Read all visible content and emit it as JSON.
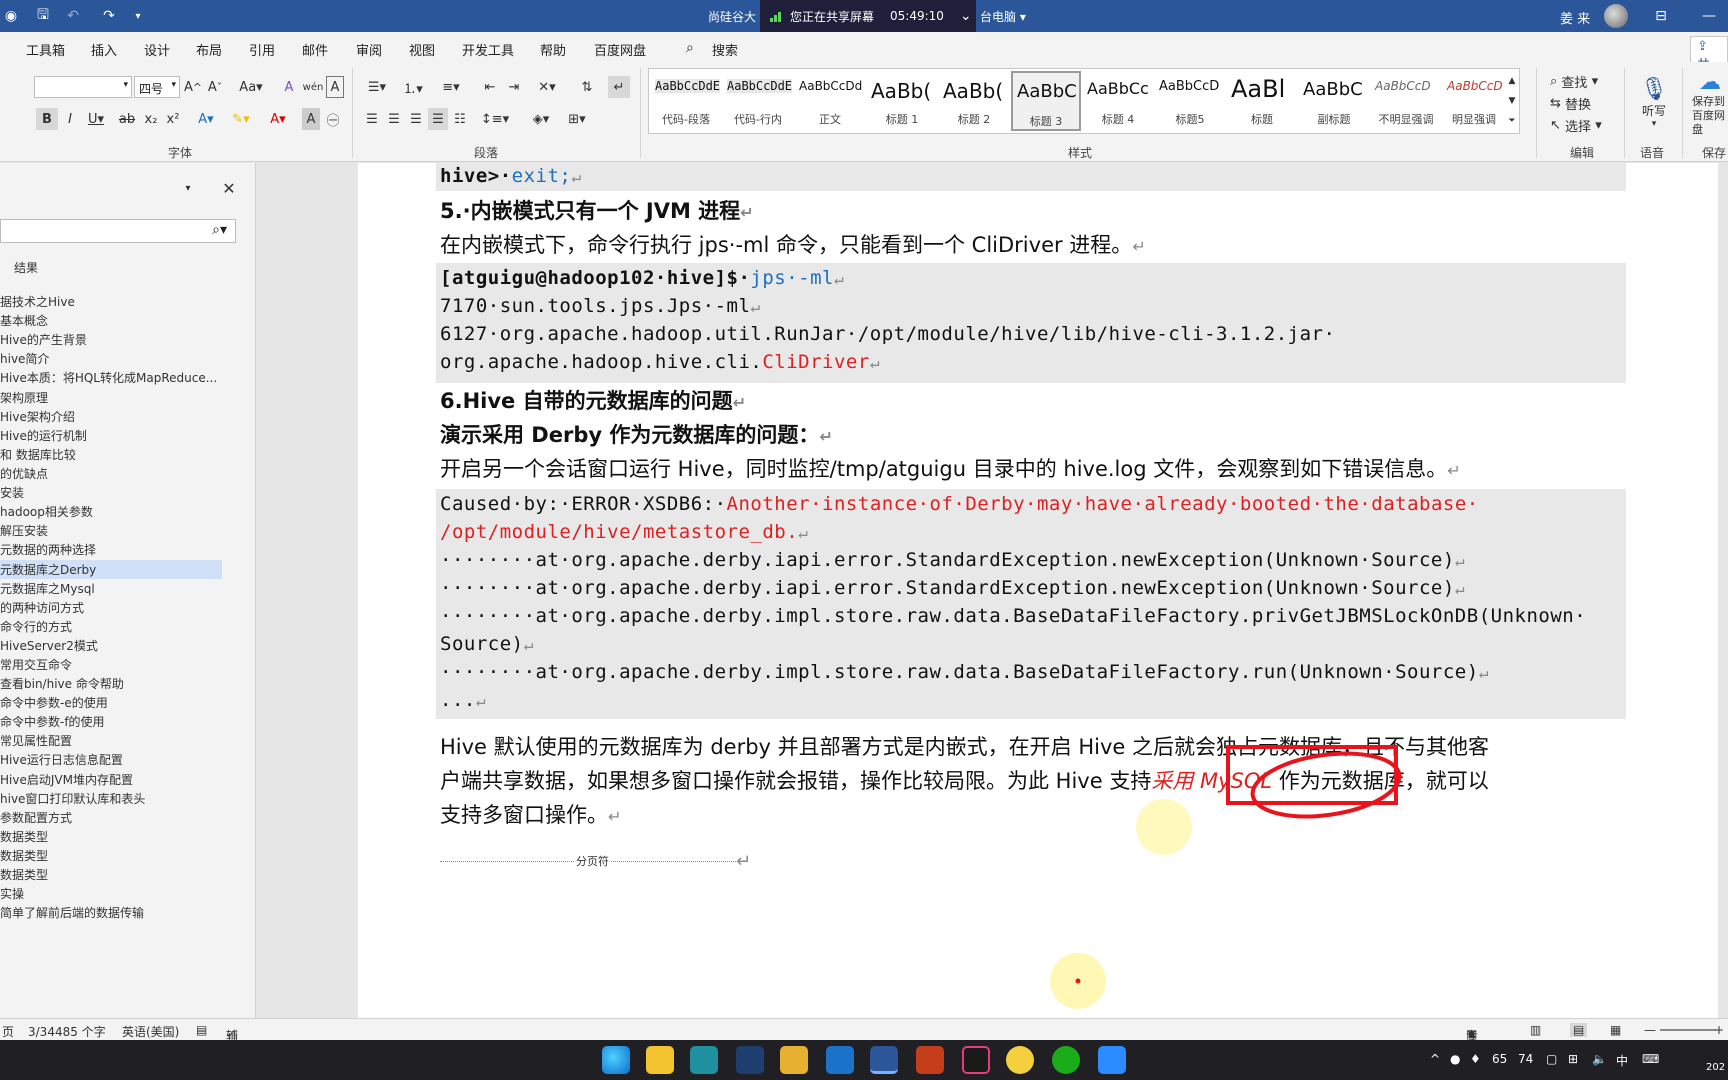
{
  "titlebar": {
    "doc_title_left": "尚硅谷大",
    "share_text": "您正在共享屏幕",
    "share_time": "05:49:10",
    "doc_title_right": "台电脑",
    "user_name": "姜 来"
  },
  "menu": {
    "tabs": [
      "工具箱",
      "插入",
      "设计",
      "布局",
      "引用",
      "邮件",
      "审阅",
      "视图",
      "开发工具",
      "帮助",
      "百度网盘",
      "搜索"
    ],
    "share_label": "共享"
  },
  "ribbon": {
    "font_size": "四号",
    "group_font": "字体",
    "group_paragraph": "段落",
    "group_styles": "样式",
    "group_edit": "编辑",
    "group_voice": "语音",
    "group_save": "保存",
    "find": "查找",
    "replace": "替换",
    "select": "选择",
    "dictate": "听写",
    "save_to_baidu": "保存到百度网盘",
    "styles": [
      {
        "preview": "AaBbCcDdE",
        "name": "代码-段落"
      },
      {
        "preview": "AaBbCcDdE",
        "name": "代码-行内"
      },
      {
        "preview": "AaBbCcDd",
        "name": "正文"
      },
      {
        "preview": "AaBb(",
        "name": "标题 1"
      },
      {
        "preview": "AaBb(",
        "name": "标题 2"
      },
      {
        "preview": "AaBbC",
        "name": "标题 3"
      },
      {
        "preview": "AaBbCc",
        "name": "标题 4"
      },
      {
        "preview": "AaBbCcD",
        "name": "标题5"
      },
      {
        "preview": "AaBl",
        "name": "标题"
      },
      {
        "preview": "AaBbC",
        "name": "副标题"
      },
      {
        "preview": "AaBbCcD",
        "name": "不明显强调"
      },
      {
        "preview": "AaBbCcD",
        "name": "明显强调"
      }
    ]
  },
  "nav": {
    "results_label": "结果",
    "items": [
      "据技术之Hive",
      "基本概念",
      "Hive的产生背景",
      "hive简介",
      "Hive本质：将HQL转化成MapReduce...",
      "架构原理",
      "Hive架构介绍",
      "Hive的运行机制",
      "和 数据库比较",
      "的优缺点",
      "安装",
      "hadoop相关参数",
      "解压安装",
      "元数据的两种选择",
      "元数据库之Derby",
      "元数据库之Mysql",
      "的两种访问方式",
      "命令行的方式",
      "HiveServer2模式",
      "常用交互命令",
      "查看bin/hive 命令帮助",
      "命令中参数-e的使用",
      "命令中参数-f的使用",
      "常见属性配置",
      "Hive运行日志信息配置",
      "Hive启动JVM堆内存配置",
      "hive窗口打印默认库和表头",
      "参数配置方式",
      "数据类型",
      "数据类型",
      "数据类型",
      "实操",
      "简单了解前后端的数据传输"
    ],
    "active_index": 14
  },
  "doc": {
    "l1_a": "hive>·",
    "l1_b": "exit;",
    "h5": "5.·内嵌模式只有一个 JVM 进程",
    "p5": "在内嵌模式下，命令行执行 jps·-ml 命令，只能看到一个 CliDriver 进程。",
    "c1_a": "[atguigu@hadoop102·hive]$·",
    "c1_b": "jps·-ml",
    "c2": "7170·sun.tools.jps.Jps·-ml",
    "c3": "6127·org.apache.hadoop.util.RunJar·/opt/module/hive/lib/hive-cli-3.1.2.jar·",
    "c4_a": "org.apache.hadoop.hive.cli.",
    "c4_b": "CliDriver",
    "h6": "6.Hive 自带的元数据库的问题",
    "h6b": "演示采用 Derby 作为元数据库的问题：",
    "p6": "开启另一个会话窗口运行 Hive，同时监控/tmp/atguigu 目录中的 hive.log 文件，会观察到如下错误信息。",
    "e1_a": "Caused·by:·ERROR·XSDB6:·",
    "e1_b": "Another·instance·of·Derby·may·have·already·booted·the·database·",
    "e2": "/opt/module/hive/metastore_db.",
    "e3": "········at·org.apache.derby.iapi.error.StandardException.newException(Unknown·Source)",
    "e4": "········at·org.apache.derby.iapi.error.StandardException.newException(Unknown·Source)",
    "e5": "········at·org.apache.derby.impl.store.raw.data.BaseDataFileFactory.privGetJBMSLockOnDB(Unknown·",
    "e6": "Source)",
    "e7": "········at·org.apache.derby.impl.store.raw.data.BaseDataFileFactory.run(Unknown·Source)",
    "e8": "...",
    "p7_1": "Hive 默认使用的元数据库为 derby 并且部署方式是内嵌式，在开启 Hive 之后就会独占元数据库，且不与其他客",
    "p7_2a": "户端共享数据，如果想多窗口操作就会报错，操作比较局限。为此 Hive 支持",
    "p7_2b": "采用 MySQL",
    "p7_2c": " 作为元数据库，就可以",
    "p7_3": "支持多窗口操作。",
    "page_break": "分页符",
    "return_mark": "↵"
  },
  "status": {
    "page": "页",
    "words": "3/34485 个字",
    "lang": "英语(美国)",
    "access": "辅助功能: 调查",
    "focus": "专注"
  },
  "taskbar": {
    "temp": "65",
    "cpu": "74",
    "ime": "中",
    "year": "202"
  },
  "colors": {
    "title_blue": "#2b579a",
    "code_red": "#e02020",
    "code_blue": "#1e6fbf",
    "annotation_red": "#e8131b"
  }
}
